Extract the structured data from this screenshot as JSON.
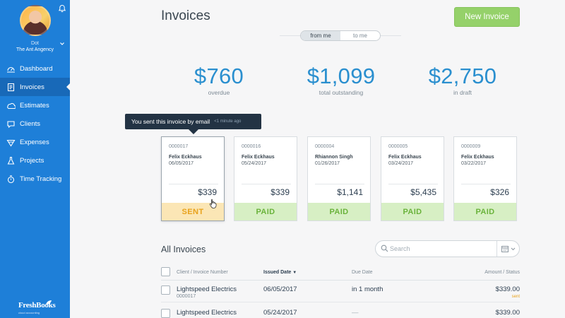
{
  "sidebar": {
    "user_name": "Dot",
    "user_company": "The Ant Angency",
    "items": [
      {
        "label": "Dashboard",
        "icon": "dashboard-icon"
      },
      {
        "label": "Invoices",
        "icon": "invoice-icon"
      },
      {
        "label": "Estimates",
        "icon": "estimate-icon"
      },
      {
        "label": "Clients",
        "icon": "clients-icon"
      },
      {
        "label": "Expenses",
        "icon": "expenses-icon"
      },
      {
        "label": "Projects",
        "icon": "projects-icon"
      },
      {
        "label": "Time Tracking",
        "icon": "timer-icon"
      }
    ],
    "active_index": 1,
    "logo": "FreshBooks",
    "logo_sub": "cloud accounting"
  },
  "header": {
    "title": "Invoices",
    "new_invoice_label": "New Invoice",
    "toggle": {
      "from_me": "from me",
      "to_me": "to me",
      "selected": "from me"
    }
  },
  "stats": [
    {
      "amount": "$760",
      "label": "overdue"
    },
    {
      "amount": "$1,099",
      "label": "total outstanding"
    },
    {
      "amount": "$2,750",
      "label": "in draft"
    }
  ],
  "tooltip": {
    "text": "You sent this invoice by email",
    "time": "<1 minute ago"
  },
  "cards": [
    {
      "number": "0000017",
      "client": "Felix Eckhaus",
      "date": "06/05/2017",
      "amount": "$339",
      "status": "SENT"
    },
    {
      "number": "0000016",
      "client": "Felix Eckhaus",
      "date": "05/24/2017",
      "amount": "$339",
      "status": "PAID"
    },
    {
      "number": "0000004",
      "client": "Rhiannon Singh",
      "date": "01/26/2017",
      "amount": "$1,141",
      "status": "PAID"
    },
    {
      "number": "0000005",
      "client": "Felix Eckhaus",
      "date": "03/24/2017",
      "amount": "$5,435",
      "status": "PAID"
    },
    {
      "number": "0000009",
      "client": "Felix Eckhaus",
      "date": "03/22/2017",
      "amount": "$326",
      "status": "PAID"
    }
  ],
  "all_invoices": {
    "title": "All Invoices",
    "search_placeholder": "Search",
    "columns": {
      "client": "Client / Invoice Number",
      "issued": "Issued Date",
      "due": "Due Date",
      "amount": "Amount / Status"
    },
    "rows": [
      {
        "client": "Lightspeed Electrics",
        "number": "0000017",
        "issued": "06/05/2017",
        "due": "in 1 month",
        "amount": "$339.00",
        "status": "sent"
      },
      {
        "client": "Lightspeed Electrics",
        "number": "",
        "issued": "05/24/2017",
        "due": "—",
        "amount": "$339.00",
        "status": ""
      }
    ]
  },
  "colors": {
    "sidebar": "#1e7fd8",
    "accent_blue": "#2a8fcf",
    "new_invoice_green": "#95d16a",
    "sent": "#e8a21b",
    "paid": "#6ab33b"
  }
}
